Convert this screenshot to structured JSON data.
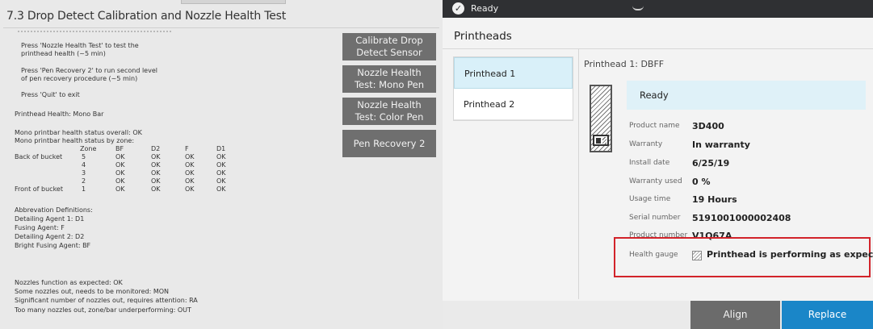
{
  "left": {
    "title": "7.3 Drop Detect Calibration and Nozzle Health Test",
    "instructions": [
      "Press 'Nozzle Health Test' to test the",
      "printhead health (~5 min)",
      "Press 'Pen Recovery 2' to run second level",
      "of pen recovery procedure (~5 min)",
      "Press 'Quit' to exit"
    ],
    "health_header": "Printhead Health: Mono Bar",
    "overall_status": "Mono printbar health status overall: OK",
    "zone_status": "Mono printbar health status by zone:",
    "columns": [
      "Zone",
      "BF",
      "D2",
      "F",
      "D1"
    ],
    "rows": [
      {
        "label": "Back of bucket",
        "zone": "5",
        "values": [
          "OK",
          "OK",
          "OK",
          "OK"
        ]
      },
      {
        "label": "",
        "zone": "4",
        "values": [
          "OK",
          "OK",
          "OK",
          "OK"
        ]
      },
      {
        "label": "",
        "zone": "3",
        "values": [
          "OK",
          "OK",
          "OK",
          "OK"
        ]
      },
      {
        "label": "",
        "zone": "2",
        "values": [
          "OK",
          "OK",
          "OK",
          "OK"
        ]
      },
      {
        "label": "Front of bucket",
        "zone": "1",
        "values": [
          "OK",
          "OK",
          "OK",
          "OK"
        ]
      }
    ],
    "abbrev_title": "Abbrevation Definitions:",
    "abbrevs": [
      "Detailing Agent 1: D1",
      "Fusing Agent: F",
      "Detailing Agent 2: D2",
      "Bright Fusing Agent: BF"
    ],
    "legend": [
      "Nozzles function as expected: OK",
      "Some nozzles out, needs to be monitored: MON",
      "Significant number of nozzles out, requires attention: RA",
      "Too many nozzles out, zone/bar underperforming: OUT"
    ],
    "buttons": [
      {
        "line1": "Calibrate Drop",
        "line2": "Detect Sensor"
      },
      {
        "line1": "Nozzle Health",
        "line2": "Test: Mono Pen"
      },
      {
        "line1": "Nozzle Health",
        "line2": "Test: Color Pen"
      },
      {
        "line1": "Pen Recovery 2",
        "line2": ""
      }
    ]
  },
  "right": {
    "status": "Ready",
    "title": "Printheads",
    "tabs": [
      "Printhead 1",
      "Printhead 2"
    ],
    "active_tab": 0,
    "printhead_header": "Printhead 1: DBFF",
    "ready_label": "Ready",
    "details": [
      {
        "label": "Product name",
        "value": "3D400"
      },
      {
        "label": "Warranty",
        "value": "In warranty"
      },
      {
        "label": "Install date",
        "value": "6/25/19"
      },
      {
        "label": "Warranty used",
        "value": "0 %"
      },
      {
        "label": "Usage time",
        "value": "19 Hours"
      },
      {
        "label": "Serial number",
        "value": "5191001000002408"
      },
      {
        "label": "Product number",
        "value": "V1Q67A"
      }
    ],
    "health_label": "Health gauge",
    "health_value": "Printhead is performing as expected.",
    "buttons": {
      "align": "Align",
      "replace": "Replace"
    },
    "colors": {
      "status_bar": "#2f3033",
      "replace": "#1a86c8",
      "highlight": "#d2232a",
      "active_tab": "#d9f0f9"
    }
  }
}
